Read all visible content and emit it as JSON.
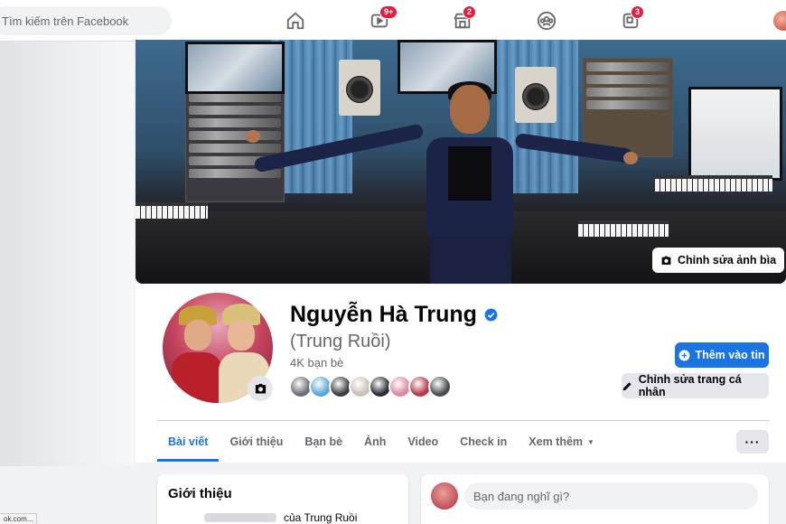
{
  "topbar": {
    "search_placeholder": "Tìm kiếm trên Facebook",
    "nav": [
      {
        "icon": "home-icon"
      },
      {
        "icon": "watch-icon",
        "badge": "9+"
      },
      {
        "icon": "marketplace-icon",
        "badge": "2"
      },
      {
        "icon": "groups-icon"
      },
      {
        "icon": "gaming-icon",
        "badge": "3"
      }
    ]
  },
  "cover": {
    "edit_label": "Chỉnh sửa ảnh bìa"
  },
  "profile": {
    "name": "Nguyễn Hà Trung",
    "alternate_name": "(Trung Ruồi)",
    "friends_count": "4K bạn bè",
    "add_story_label": "Thêm vào tin",
    "edit_profile_label": "Chỉnh sửa trang cá nhân",
    "friend_avatar_colors": [
      "#6b6f78",
      "#5aa7d6",
      "#3b3e44",
      "#c9c0b6",
      "#2a2d3a",
      "#d98aa0",
      "#b5394a",
      "#4a4d52"
    ]
  },
  "tabs": [
    {
      "label": "Bài viết",
      "active": true
    },
    {
      "label": "Giới thiệu"
    },
    {
      "label": "Bạn bè"
    },
    {
      "label": "Ảnh"
    },
    {
      "label": "Video"
    },
    {
      "label": "Check in"
    },
    {
      "label": "Xem thêm"
    }
  ],
  "more_button": "···",
  "intro": {
    "title": "Giới thiệu",
    "line_suffix": "của Trung Ruồi"
  },
  "composer": {
    "placeholder": "Bạn đang nghĩ gì?"
  },
  "status_bar": {
    "url_text": "ok.com..."
  },
  "colors": {
    "accent": "#1b74e4",
    "badge": "#e41e3f",
    "background": "#f0f2f5"
  }
}
